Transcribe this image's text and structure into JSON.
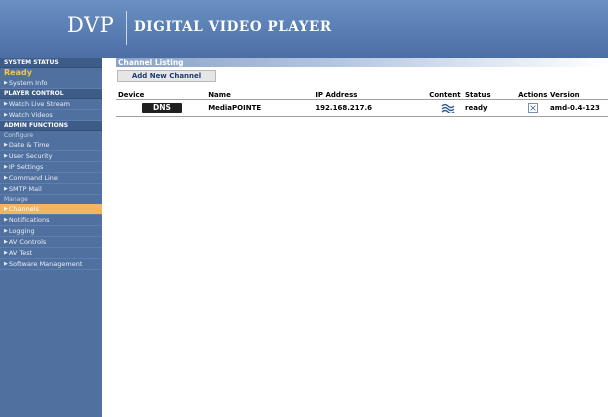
{
  "header": {
    "logo": "DVP",
    "title": "DIGITAL VIDEO PLAYER"
  },
  "sidebar": {
    "system_status": "SYSTEM STATUS",
    "status_value": "Ready",
    "system_info": "System Info",
    "player_control": "PLAYER CONTROL",
    "watch_live_stream": "Watch Live Stream",
    "watch_videos": "Watch Videos",
    "admin_functions": "ADMIN FUNCTIONS",
    "configure": "Configure",
    "date_time": "Date & Time",
    "user_security": "User Security",
    "ip_settings": "IP Settings",
    "command_line": "Command Line",
    "smtp_mail": "SMTP Mail",
    "manage": "Manage",
    "channels": "Channels",
    "notifications": "Notifications",
    "logging": "Logging",
    "av_controls": "AV Controls",
    "av_test": "AV Test",
    "software_management": "Software Management"
  },
  "main": {
    "listing_title": "Channel Listing",
    "add_button": "Add New Channel",
    "columns": [
      "Device",
      "Name",
      "IP Address",
      "Content",
      "Status",
      "Actions",
      "Version"
    ],
    "rows": [
      {
        "device": "DNS",
        "name": "MediaPOINTE",
        "ip": "192.168.217.6",
        "content_icon": "stream-waves-icon",
        "status": "ready",
        "action_icon": "delete-x-icon",
        "version": "amd-0.4-123"
      }
    ]
  },
  "colors": {
    "header": "#5a7fb4",
    "sidebar": "#50709f",
    "sidebar_head": "#3d5c88",
    "active_item": "#f4b560",
    "status_ready": "#f6c25a",
    "wave_icon": "#2f5c96"
  }
}
